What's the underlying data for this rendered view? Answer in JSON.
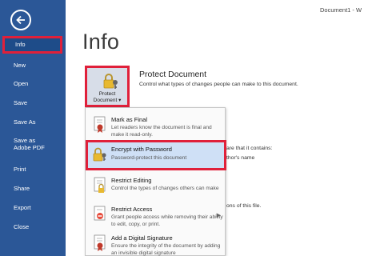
{
  "window": {
    "doc_title": "Document1 - W"
  },
  "sidebar": {
    "items": [
      {
        "label": "Info"
      },
      {
        "label": "New"
      },
      {
        "label": "Open"
      },
      {
        "label": "Save"
      },
      {
        "label": "Save As"
      },
      {
        "label": "Save as Adobe PDF"
      },
      {
        "label": "Print"
      },
      {
        "label": "Share"
      },
      {
        "label": "Export"
      },
      {
        "label": "Close"
      }
    ]
  },
  "main": {
    "title": "Info",
    "protect": {
      "button_line1": "Protect",
      "button_line2": "Document",
      "heading": "Protect Document",
      "description": "Control what types of changes people can make to this document."
    },
    "side_texts": {
      "inspect": "are that it contains:",
      "author": "thor's name",
      "versions": "ons of this file."
    },
    "menu": [
      {
        "title": "Mark as Final",
        "desc": "Let readers know the document is final and make it read-only."
      },
      {
        "title": "Encrypt with Password",
        "desc": "Password-protect this document"
      },
      {
        "title": "Restrict Editing",
        "desc": "Control the types of changes others can make"
      },
      {
        "title": "Restrict Access",
        "desc": "Grant people access while removing their ability to edit, copy, or print."
      },
      {
        "title": "Add a Digital Signature",
        "desc": "Ensure the integrity of the document by adding an invisible digital signature"
      }
    ]
  },
  "colors": {
    "sidebar": "#2b5797",
    "highlight_border": "#e0203a",
    "menu_highlight": "#cfe0f6"
  }
}
